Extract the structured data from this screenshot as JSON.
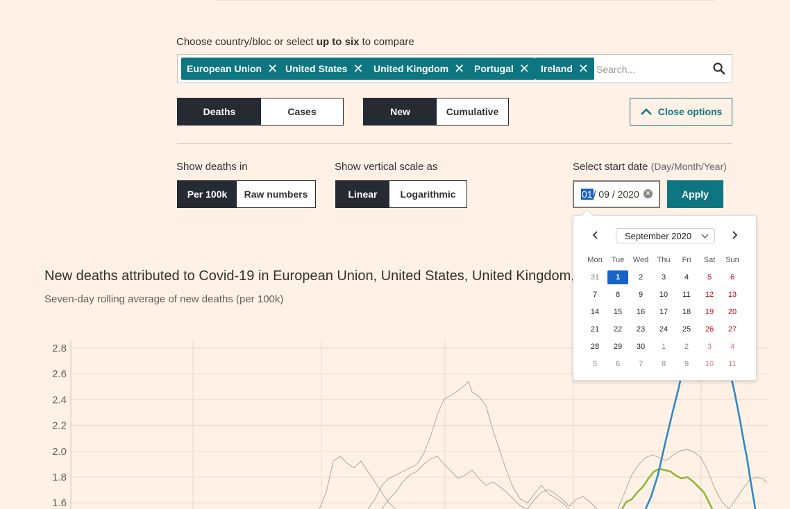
{
  "selector": {
    "label_pre": "Choose country/bloc or select ",
    "label_bold": "up to six",
    "label_post": " to compare",
    "tags": [
      "European Union",
      "United States",
      "United Kingdom",
      "Portugal",
      "Ireland"
    ],
    "search_placeholder": "Search..."
  },
  "metric_toggle": {
    "options": [
      "Deaths",
      "Cases"
    ],
    "selected": "Deaths"
  },
  "mode_toggle": {
    "options": [
      "New",
      "Cumulative"
    ],
    "selected": "New"
  },
  "close_options_label": "Close options",
  "show_in": {
    "label": "Show deaths in",
    "options": [
      "Per 100k",
      "Raw numbers"
    ],
    "selected": "Per 100k"
  },
  "scale": {
    "label": "Show vertical scale as",
    "options": [
      "Linear",
      "Logarithmic"
    ],
    "selected": "Linear"
  },
  "start_date": {
    "label": "Select start date",
    "hint": "(Day/Month/Year)",
    "day": "01",
    "rest": "/ 09 / 2020",
    "apply_label": "Apply"
  },
  "calendar": {
    "month_label": "September 2020",
    "weekdays": [
      "Mon",
      "Tue",
      "Wed",
      "Thu",
      "Fri",
      "Sat",
      "Sun"
    ],
    "weeks": [
      [
        "31",
        "1",
        "2",
        "3",
        "4",
        "5",
        "6"
      ],
      [
        "7",
        "8",
        "9",
        "10",
        "11",
        "12",
        "13"
      ],
      [
        "14",
        "15",
        "16",
        "17",
        "18",
        "19",
        "20"
      ],
      [
        "21",
        "22",
        "23",
        "24",
        "25",
        "26",
        "27"
      ],
      [
        "28",
        "29",
        "30",
        "1",
        "2",
        "3",
        "4"
      ],
      [
        "5",
        "6",
        "7",
        "8",
        "9",
        "10",
        "11"
      ]
    ],
    "selected_day": "1"
  },
  "chart": {
    "title": "New deaths attributed to Covid-19 in European Union, United States, United Kingdom, Portugal and Ireland",
    "subtitle": "Seven-day rolling average of new deaths (per 100k)"
  },
  "chart_data": {
    "type": "line",
    "yticks": [
      "2.8",
      "2.6",
      "2.4",
      "2.2",
      "2.0",
      "1.8",
      "1.6"
    ],
    "ylim": [
      1.6,
      2.8
    ],
    "grid": true,
    "colors": {
      "highlight_blue": "#2b8ac6",
      "highlight_green": "#8ab83a",
      "background_series": "#a89e95"
    }
  },
  "colors": {
    "accent": "#0d7680",
    "dark": "#262a33",
    "background": "#fff1e5"
  }
}
